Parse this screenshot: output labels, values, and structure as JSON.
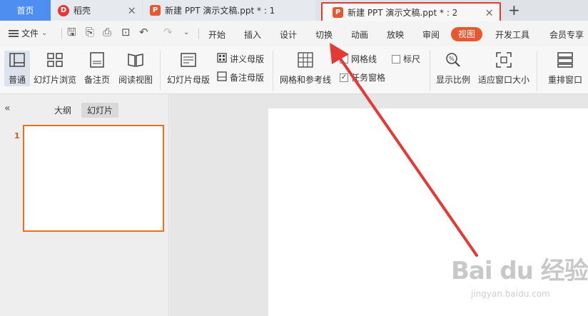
{
  "tabs": {
    "home": "首页",
    "daoke": "稻壳",
    "daoke_icon": "D",
    "doc1": "新建 PPT 演示文稿.ppt * : 1",
    "doc2": "新建 PPT 演示文稿.ppt * : 2",
    "ppt_icon": "P",
    "close": "×",
    "plus": "+"
  },
  "menubar": {
    "file": "文件",
    "items": [
      "开始",
      "插入",
      "设计",
      "切换",
      "动画",
      "放映",
      "审阅",
      "视图",
      "开发工具",
      "会员专享"
    ],
    "active": "视图",
    "quick_icons": [
      "save-icon",
      "export-pdf-icon",
      "print-icon",
      "print-preview-icon",
      "undo-icon",
      "redo-icon",
      "more-icon"
    ]
  },
  "ribbon": {
    "normal": "普通",
    "slide_sorter": "幻灯片浏览",
    "notes_page": "备注页",
    "reading_view": "阅读视图",
    "slide_master": "幻灯片母版",
    "handout_master": "讲义母版",
    "notes_master": "备注母版",
    "grid_guides": "网格和参考线",
    "gridlines": "网格线",
    "ruler": "标尺",
    "task_pane": "任务窗格",
    "zoom": "显示比例",
    "fit_window": "适应窗口大小",
    "arrange": "重排窗口"
  },
  "left_panel": {
    "collapse": "«",
    "outline": "大纲",
    "slides": "幻灯片",
    "slide_number": "1"
  },
  "watermark": {
    "brand": "Bai du 经验",
    "url": "jingyan.baidu.com"
  },
  "colors": {
    "accent": "#e8582f",
    "home_tab": "#4e8ef0",
    "highlight_box": "#e53935",
    "thumb_border": "#e8701f"
  }
}
